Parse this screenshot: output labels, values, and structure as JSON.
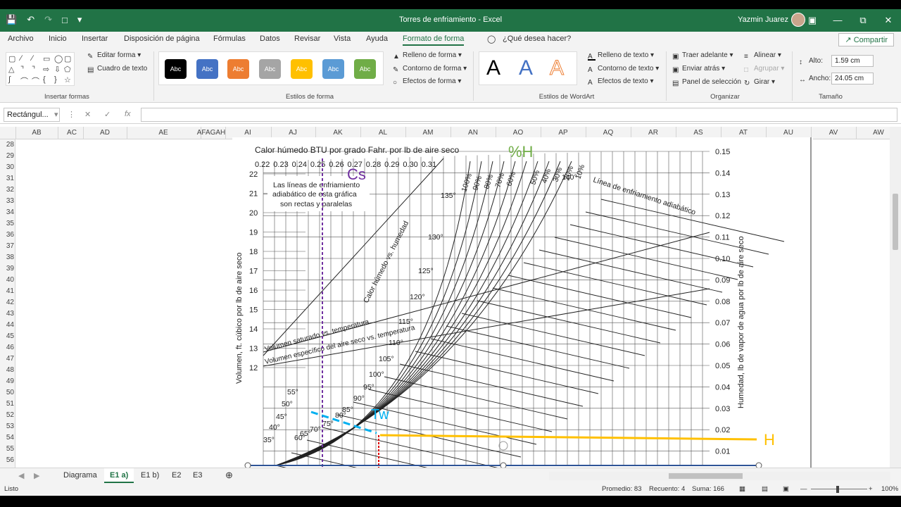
{
  "window": {
    "title": "Torres de enfriamiento  -  Excel",
    "user": "Yazmin Juarez"
  },
  "tabs": [
    "Archivo",
    "Inicio",
    "Insertar",
    "Disposición de página",
    "Fórmulas",
    "Datos",
    "Revisar",
    "Vista",
    "Ayuda",
    "Formato de forma"
  ],
  "search": "¿Qué desea hacer?",
  "share": "Compartir",
  "ribbon": {
    "insert_shapes": {
      "edit_shape": "Editar forma",
      "text_box": "Cuadro de texto",
      "label": "Insertar formas"
    },
    "shape_styles": {
      "abc": "Abc",
      "fill": "Relleno de forma",
      "outline": "Contorno de forma",
      "effects": "Efectos de forma",
      "label": "Estilos de forma"
    },
    "wordart": {
      "letter": "A",
      "text_fill": "Relleno de texto",
      "text_outline": "Contorno de texto",
      "text_effects": "Efectos de texto",
      "label": "Estilos de WordArt"
    },
    "arrange": {
      "bring_forward": "Traer adelante",
      "send_backward": "Enviar atrás",
      "selection_pane": "Panel de selección",
      "align": "Alinear",
      "group": "Agrupar",
      "rotate": "Girar",
      "label": "Organizar"
    },
    "size": {
      "height_label": "Alto:",
      "height_value": "1.59 cm",
      "width_label": "Ancho:",
      "width_value": "24.05 cm",
      "label": "Tamaño"
    }
  },
  "namebox": "Rectángul...",
  "columns": [
    "AB",
    "AC",
    "AD",
    "AE",
    "AFAGAH",
    "AI",
    "AJ",
    "AK",
    "AL",
    "AM",
    "AN",
    "AO",
    "AP",
    "AQ",
    "AR",
    "AS",
    "AT",
    "AU",
    "AV",
    "AW"
  ],
  "rows": [
    "28",
    "29",
    "30",
    "31",
    "32",
    "33",
    "34",
    "35",
    "36",
    "37",
    "38",
    "39",
    "40",
    "41",
    "42",
    "43",
    "44",
    "45",
    "46",
    "47",
    "48",
    "49",
    "50",
    "51",
    "52",
    "53",
    "54",
    "55",
    "56"
  ],
  "chart": {
    "top_title": "Calor húmedo BTU por grado Fahr. por lb de aire seco",
    "cs_ticks": [
      "0.22",
      "0.23",
      "0.24",
      "0.25",
      "0.26",
      "0.27",
      "0.28",
      "0.29",
      "0.30",
      "0.31"
    ],
    "left_label": "Volumen, ft. cúbico por lb de aire seco",
    "right_label": "Humedad, lb de vapor de agua por lb de aire seco",
    "left_ticks": [
      "22",
      "21",
      "20",
      "19",
      "18",
      "17",
      "16",
      "15",
      "14",
      "13",
      "12"
    ],
    "right_ticks": [
      "0.15",
      "0.14",
      "0.13",
      "0.12",
      "0.11",
      "0.10",
      "0.09",
      "0.08",
      "0.07",
      "0.06",
      "0.05",
      "0.04",
      "0.03",
      "0.02",
      "0.01"
    ],
    "note_line1": "Las líneas de enfriamiento",
    "note_line2": "adiabático de esta gráfica",
    "note_line3": "son rectas y paralelas",
    "cs_annot": "Cs",
    "ph_annot": "%H",
    "tw_annot": "Tw",
    "h_annot": "H",
    "adiabatic_label": "Línea de enfriamiento adiabático",
    "humid_heat_label": "Calor húmedo vs. humedad",
    "sat_vol_label": "Volumen saturado vs. temperatura",
    "spec_vol_label": "Volumen específico del aire seco vs. temperatura",
    "pct_labels": [
      "100%",
      "90%",
      "80%",
      "70%",
      "60%",
      "50%",
      "40%",
      "30%",
      "20%",
      "10%"
    ],
    "temp_labels": [
      "140°",
      "135°",
      "130°",
      "125°",
      "120°",
      "115°",
      "110°",
      "105°",
      "100°",
      "95°",
      "90°",
      "85°",
      "80°",
      "75°",
      "70°",
      "65°",
      "60°",
      "55°",
      "50°",
      "45°",
      "40°",
      "35°"
    ],
    "colors": {
      "cs": "#7030a0",
      "ph": "#70ad47",
      "tw": "#00b0f0",
      "h": "#ffc000",
      "vline": "#7030a0",
      "redline": "#e00000"
    }
  },
  "sheets": [
    "Diagrama",
    "E1 a)",
    "E1 b)",
    "E2",
    "E3"
  ],
  "active_sheet": "E1 a)",
  "status": {
    "ready": "Listo",
    "average": "Promedio: 83",
    "count": "Recuento: 4",
    "sum": "Suma: 166",
    "zoom": "100%"
  }
}
